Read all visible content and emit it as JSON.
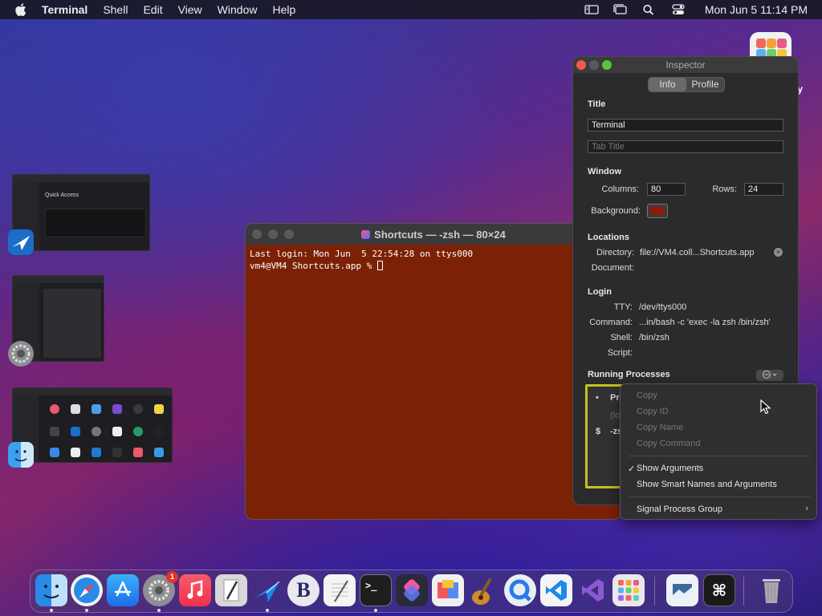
{
  "menubar": {
    "items": [
      "Terminal",
      "Shell",
      "Edit",
      "View",
      "Window",
      "Help"
    ],
    "clock": "Mon Jun 5  11:14 PM",
    "icons": [
      "apple-icon",
      "sidebar-icon",
      "window-icon",
      "search-icon",
      "control-center-icon"
    ]
  },
  "desktop": {
    "icon_label": "py"
  },
  "thumbnails": {
    "t1_title": "Quick Access"
  },
  "terminal": {
    "title": "Shortcuts — -zsh — 80×24",
    "line1": "Last login: Mon Jun  5 22:54:28 on ttys000",
    "line2": "vm4@VM4 Shortcuts.app % ",
    "bg_color": "#7b2106"
  },
  "inspector": {
    "window_title": "Inspector",
    "tabs": [
      "Info",
      "Profile"
    ],
    "title_section": "Title",
    "title_value": "Terminal",
    "tab_title_placeholder": "Tab Title",
    "window_section": "Window",
    "columns_label": "Columns:",
    "columns_value": "80",
    "rows_label": "Rows:",
    "rows_value": "24",
    "background_label": "Background:",
    "locations_section": "Locations",
    "directory_label": "Directory:",
    "directory_value": "file://VM4.coll...Shortcuts.app",
    "document_label": "Document:",
    "login_section": "Login",
    "tty_label": "TTY:",
    "tty_value": "/dev/ttys000",
    "command_label": "Command:",
    "command_value": "...in/bash -c 'exec -la zsh /bin/zsh'",
    "shell_label": "Shell:",
    "shell_value": "/bin/zsh",
    "script_label": "Script:",
    "running_section": "Running Processes",
    "proc_col": "Pr",
    "proc_row1": "(lo",
    "proc_row2": "-zs",
    "proc_row_icon": "$"
  },
  "context_menu": {
    "items": [
      {
        "label": "Copy",
        "enabled": false
      },
      {
        "label": "Copy ID",
        "enabled": false
      },
      {
        "label": "Copy Name",
        "enabled": false
      },
      {
        "label": "Copy Command",
        "enabled": false
      },
      {
        "label": "Show Arguments",
        "checked": true
      },
      {
        "label": "Show Smart Names and Arguments"
      },
      {
        "label": "Signal Process Group",
        "submenu": true
      }
    ],
    "check": "✓",
    "arrow": "›"
  },
  "dock": {
    "apps": [
      "finder-icon",
      "safari-icon",
      "app-store-icon",
      "system-settings-icon",
      "music-icon",
      "script-editor-icon",
      "xcode-cloud-icon",
      "bbedit-icon",
      "textedit-icon",
      "terminal-icon",
      "shortcuts-icon",
      "font-book-icon",
      "garageband-icon",
      "quicktime-icon",
      "vscode-icon",
      "visual-studio-icon",
      "launchpad-icon",
      "preview-icon",
      "keyboard-icon",
      "trash-icon"
    ],
    "settings_badge": "1",
    "bbedit_glyph": "B",
    "terminal_glyph": ">_",
    "keyboard_glyph": "⌘"
  }
}
